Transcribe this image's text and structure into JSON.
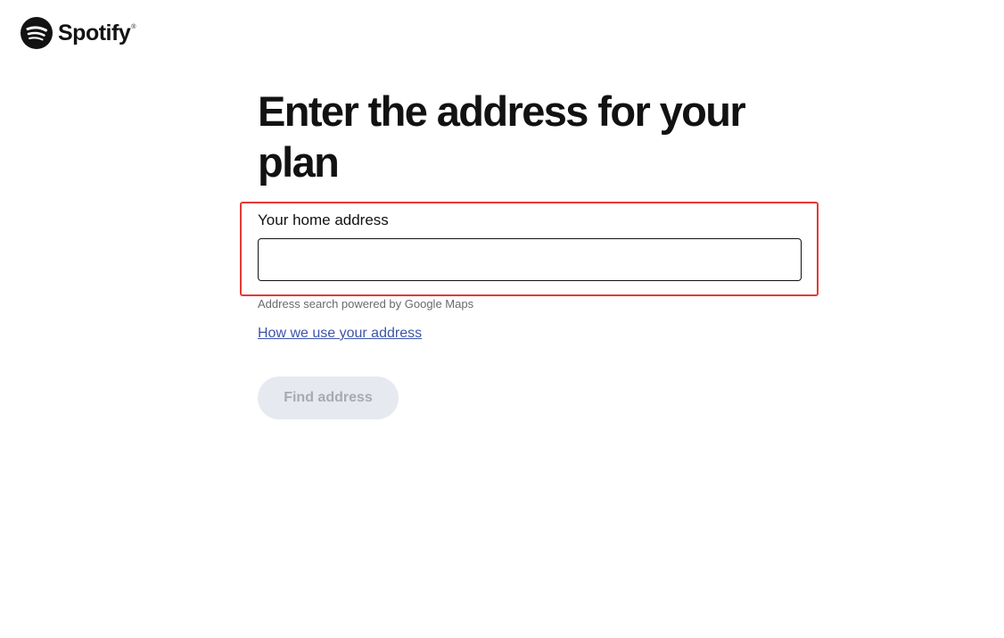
{
  "brand": {
    "name": "Spotify",
    "trademark": "®",
    "logo_icon": "spotify-logo-icon"
  },
  "page": {
    "title": "Enter the address for your plan"
  },
  "address_field": {
    "label": "Your home address",
    "value": "",
    "placeholder": ""
  },
  "helper_text": "Address search powered by Google Maps",
  "link_text": "How we use your address",
  "find_button": {
    "label": "Find address",
    "state": "disabled"
  },
  "colors": {
    "highlight_border": "#e53935",
    "link": "#3d55a8",
    "button_disabled_bg": "#e6e9ef",
    "button_disabled_text": "#a7aab2"
  }
}
